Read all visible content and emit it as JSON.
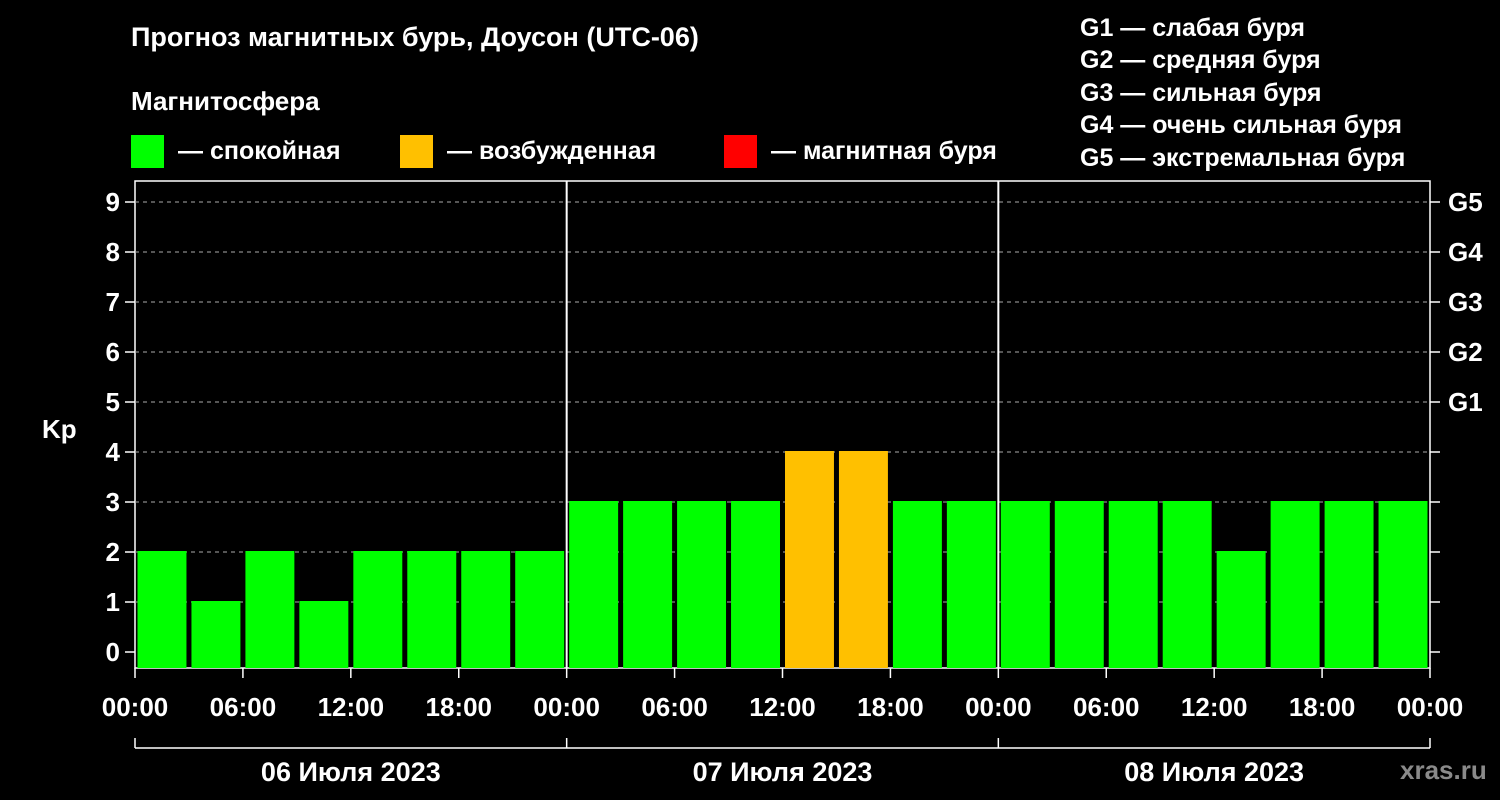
{
  "title": "Прогноз магнитных бурь, Доусон (UTC-06)",
  "magnetosphere": {
    "title": "Магнитосфера",
    "items": [
      {
        "label": "— спокойная",
        "color": "#00ff00"
      },
      {
        "label": "— возбужденная",
        "color": "#ffc000"
      },
      {
        "label": "— магнитная буря",
        "color": "#ff0000"
      }
    ]
  },
  "g_legend": [
    "G1 — слабая буря",
    "G2 — средняя буря",
    "G3 — сильная буря",
    "G4 — очень сильная буря",
    "G5 — экстремальная буря"
  ],
  "watermark": "xras.ru",
  "chart_data": {
    "type": "bar",
    "ylabel": "Kp",
    "ylim": [
      0,
      9
    ],
    "yticks": [
      "0",
      "1",
      "2",
      "3",
      "4",
      "5",
      "6",
      "7",
      "8",
      "9"
    ],
    "g_ticks": [
      {
        "kp": 5,
        "label": "G1"
      },
      {
        "kp": 6,
        "label": "G2"
      },
      {
        "kp": 7,
        "label": "G3"
      },
      {
        "kp": 8,
        "label": "G4"
      },
      {
        "kp": 9,
        "label": "G5"
      }
    ],
    "x_time_labels": [
      "00:00",
      "06:00",
      "12:00",
      "18:00",
      "00:00",
      "06:00",
      "12:00",
      "18:00",
      "00:00",
      "06:00",
      "12:00",
      "18:00",
      "00:00"
    ],
    "days": [
      "06 Июля 2023",
      "07 Июля 2023",
      "08 Июля 2023"
    ],
    "interval_hours": 3,
    "values": [
      2,
      1,
      2,
      1,
      2,
      2,
      2,
      2,
      3,
      3,
      3,
      3,
      4,
      4,
      3,
      3,
      3,
      3,
      3,
      3,
      2,
      3,
      3,
      3
    ],
    "colors": {
      "quiet": "#00ff00",
      "active": "#ffc000",
      "storm": "#ff0000"
    },
    "grid": true
  }
}
